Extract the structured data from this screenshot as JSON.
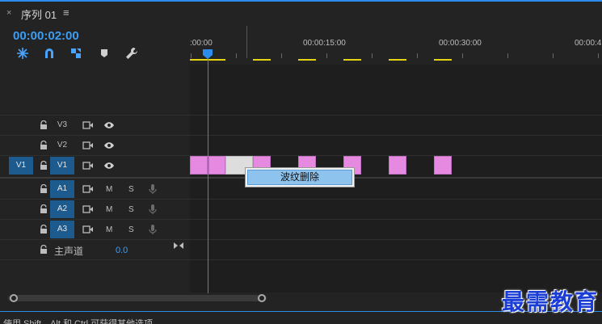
{
  "colors": {
    "accent": "#2d8ceb",
    "clip": "#e58ae0",
    "render_bar": "#e5d312",
    "track_target": "#1d5b8f"
  },
  "tab": {
    "close_icon": "×",
    "title": "序列 01",
    "menu_icon": "≡"
  },
  "timecode": "00:00:02:00",
  "tools": [
    {
      "name": "snap-nested-icon"
    },
    {
      "name": "snap-magnet-icon"
    },
    {
      "name": "linked-selection-icon"
    },
    {
      "name": "add-marker-icon"
    },
    {
      "name": "wrench-settings-icon"
    }
  ],
  "ruler": {
    "labels": [
      ":00:00",
      "00:00:15:00",
      "00:00:30:00",
      "00:00:4"
    ]
  },
  "tracks": {
    "video": [
      {
        "source": "",
        "label": "V3",
        "target": false
      },
      {
        "source": "",
        "label": "V2",
        "target": false
      },
      {
        "source": "V1",
        "label": "V1",
        "target": true
      }
    ],
    "audio": [
      {
        "label": "A1",
        "m": "M",
        "s": "S"
      },
      {
        "label": "A2",
        "m": "M",
        "s": "S"
      },
      {
        "label": "A3",
        "m": "M",
        "s": "S"
      }
    ],
    "master": {
      "label": "主声道",
      "value": "0.0"
    }
  },
  "context_menu": {
    "item": "波纹删除"
  },
  "status_text": "使用 Shift、Alt 和 Ctrl 可获得其他选项。",
  "watermark": "最需教育"
}
